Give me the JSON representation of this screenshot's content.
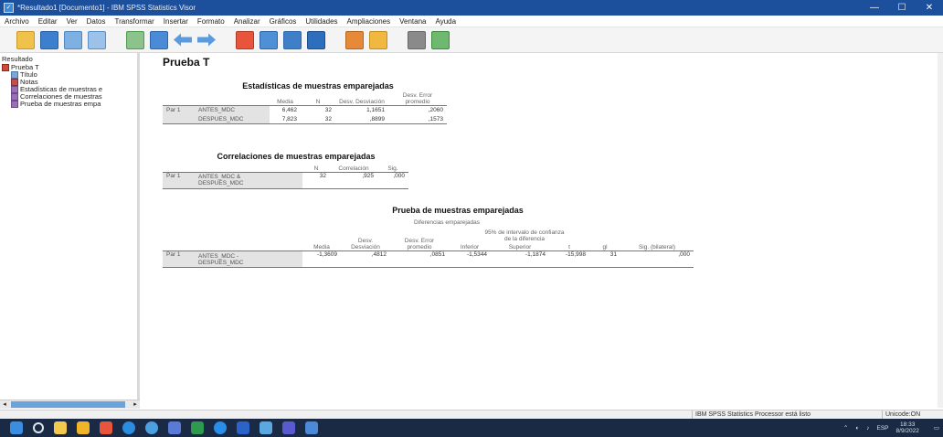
{
  "window": {
    "title": "*Resultado1 [Documento1] - IBM SPSS Statistics Visor",
    "minimize": "—",
    "maximize": "☐",
    "close": "✕"
  },
  "menu": [
    "Archivo",
    "Editar",
    "Ver",
    "Datos",
    "Transformar",
    "Insertar",
    "Formato",
    "Analizar",
    "Gráficos",
    "Utilidades",
    "Ampliaciones",
    "Ventana",
    "Ayuda"
  ],
  "toolbar_icons": [
    "open-folder-icon",
    "save-icon",
    "print-icon",
    "print-preview-icon",
    "export-icon",
    "recall-dialog-icon",
    "undo-icon",
    "redo-icon",
    "goto-data-icon",
    "goto-case-icon",
    "goto-variable-icon",
    "variables-icon",
    "insert-output-icon",
    "designate-window-icon",
    "show-hide-icon",
    "promote-icon"
  ],
  "outline": {
    "root": "Resultado",
    "items": [
      {
        "label": "Prueba T",
        "level": 1,
        "icon": "book-icon"
      },
      {
        "label": "Título",
        "level": 2,
        "icon": "title-icon"
      },
      {
        "label": "Notas",
        "level": 2,
        "icon": "notes-icon"
      },
      {
        "label": "Estadísticas de muestras e",
        "level": 2,
        "icon": "table-icon"
      },
      {
        "label": "Correlaciones de muestras",
        "level": 2,
        "icon": "table-icon"
      },
      {
        "label": "Prueba de muestras empa",
        "level": 2,
        "icon": "table-icon"
      }
    ]
  },
  "content": {
    "heading": "Prueba T",
    "stats": {
      "title": "Estadísticas de muestras emparejadas",
      "headers": [
        "Media",
        "N",
        "Desv. Desviación",
        "Desv. Error promedio"
      ],
      "pair": "Par 1",
      "rows": [
        {
          "var": "ANTES_MDC",
          "media": "6,462",
          "n": "32",
          "sd": "1,1651",
          "se": ",2060"
        },
        {
          "var": "DESPUES_MDC",
          "media": "7,823",
          "n": "32",
          "sd": ",8899",
          "se": ",1573"
        }
      ]
    },
    "corr": {
      "title": "Correlaciones de muestras emparejadas",
      "headers": [
        "N",
        "Correlación",
        "Sig."
      ],
      "pair": "Par 1",
      "var1": "ANTES_MDC &",
      "var2": "DESPUES_MDC",
      "n": "32",
      "r": ",925",
      "sig": ",000"
    },
    "test": {
      "title": "Prueba de muestras emparejadas",
      "group_header": "Diferencias emparejadas",
      "ci_header_1": "95% de intervalo de confianza",
      "ci_header_2": "de la diferencia",
      "headers": [
        "Media",
        "Desv. Desviación",
        "Desv. Error promedio",
        "Inferior",
        "Superior",
        "t",
        "gl",
        "Sig. (bilateral)"
      ],
      "pair": "Par 1",
      "var1": "ANTES_MDC -",
      "var2": "DESPUES_MDC",
      "values": [
        "-1,3609",
        ",4812",
        ",0851",
        "-1,5344",
        "-1,1874",
        "-15,998",
        "31",
        ",000"
      ]
    }
  },
  "status": {
    "processor": "IBM SPSS Statistics Processor está listo",
    "unicode": "Unicode:ON"
  },
  "taskbar": {
    "lang": "ESP",
    "time": "18:33",
    "date": "8/9/2022"
  }
}
